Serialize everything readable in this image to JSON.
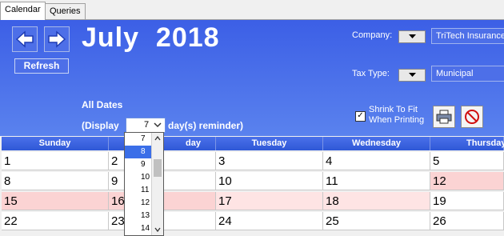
{
  "tabs": [
    {
      "label": "Calendar",
      "active": true
    },
    {
      "label": "Queries",
      "active": false
    }
  ],
  "toolbar": {
    "back_icon": "arrow-left-icon",
    "forward_icon": "arrow-right-icon",
    "refresh_label": "Refresh"
  },
  "month_title": "July  2018",
  "filters": {
    "company_label": "Company:",
    "company_value": "TriTech Insurance",
    "tax_type_label": "Tax Type:",
    "tax_type_value": "Municipal"
  },
  "all_dates_label": "All Dates",
  "reminder": {
    "prefix": "(Display",
    "value": "7",
    "suffix": "day(s) reminder)",
    "options": [
      "7",
      "8",
      "9",
      "10",
      "11",
      "12",
      "13",
      "14"
    ],
    "highlighted": "8"
  },
  "shrink_to_fit": {
    "label_line1": "Shrink To Fit",
    "label_line2": "When Printing",
    "checked": true,
    "check_mark": "✓"
  },
  "icons": {
    "print": "printer-icon",
    "clear": "no-entry-icon"
  },
  "colors": {
    "panel": "#3c5fe6",
    "header": "#2f58d6",
    "highlight": "#fbd3d3",
    "highlight_light": "#fee4e4",
    "dropdown_selected": "#3a6ee8"
  },
  "calendar": {
    "day_headers": [
      "Sunday",
      "Monday",
      "Tuesday",
      "Wednesday",
      "Thursday"
    ],
    "day_headers_visible": [
      "Sunday",
      "day",
      "Tuesday",
      "Wednesday",
      "Thursday"
    ],
    "rows": [
      [
        "1",
        "2",
        "3",
        "4",
        "5"
      ],
      [
        "8",
        "9",
        "10",
        "11",
        "12"
      ],
      [
        "15",
        "16",
        "17",
        "18",
        "19"
      ],
      [
        "22",
        "23",
        "24",
        "25",
        "26"
      ]
    ],
    "highlighted_cells": [
      [
        "1",
        "4"
      ],
      [
        "2",
        "0"
      ],
      [
        "2",
        "1"
      ],
      [
        "2",
        "2"
      ],
      [
        "2",
        "3"
      ]
    ]
  }
}
